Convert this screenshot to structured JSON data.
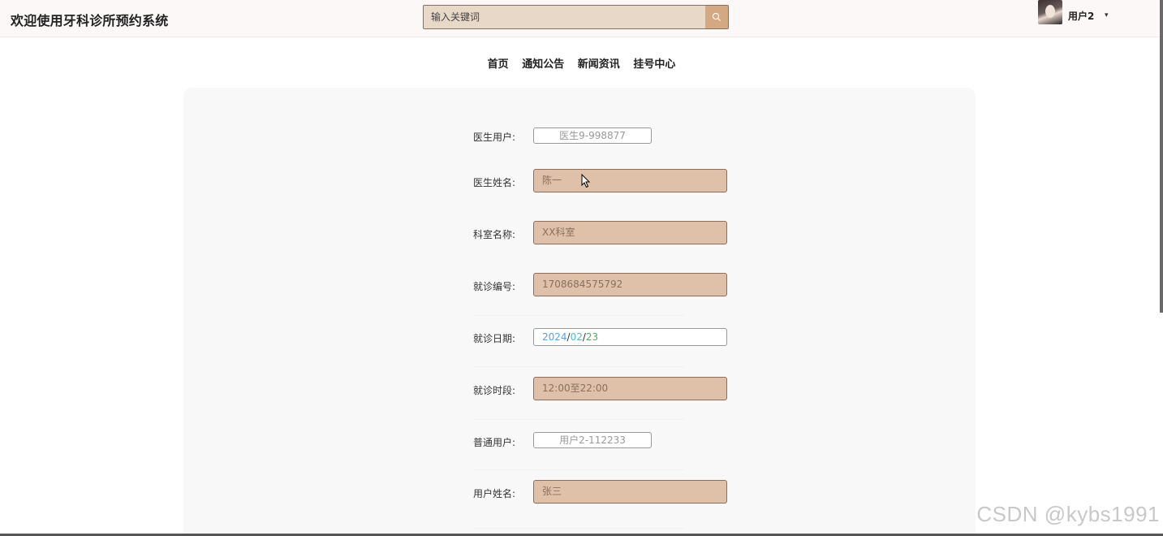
{
  "header": {
    "site_title": "欢迎使用牙科诊所预约系统",
    "search_placeholder": "输入关键词",
    "user_name": "用户2",
    "caret": "▾"
  },
  "nav": {
    "items": [
      "首页",
      "通知公告",
      "新闻资讯",
      "挂号中心"
    ]
  },
  "form": {
    "doctor_account": {
      "label": "医生用户:",
      "value": "医生9-998877"
    },
    "doctor_name": {
      "label": "医生姓名:",
      "value": "陈一"
    },
    "department": {
      "label": "科室名称:",
      "value": "XX科室"
    },
    "visit_no": {
      "label": "就诊编号:",
      "value": "1708684575792"
    },
    "visit_date": {
      "label": "就诊日期:",
      "year": "2024",
      "month": "02",
      "day": "23",
      "sep": "/"
    },
    "visit_slot": {
      "label": "就诊时段:",
      "value": "12:00至22:00"
    },
    "user_account": {
      "label": "普通用户:",
      "value": "用户2-112233"
    },
    "user_name": {
      "label": "用户姓名:",
      "value": "张三"
    }
  },
  "watermark": "CSDN @kybs1991",
  "colors": {
    "header_bg": "#fdf8f8",
    "search_bg": "#e8d8c8",
    "search_button": "#d4a882",
    "field_fill": "#dfc0a8",
    "panel_bg": "#f8f8f8",
    "date_year": "#5aa0d8",
    "date_month": "#58b8d0",
    "date_day": "#4fae5a"
  },
  "icons": {
    "search": "search-icon",
    "caret": "chevron-down-icon",
    "cursor": "mouse-pointer-icon"
  }
}
